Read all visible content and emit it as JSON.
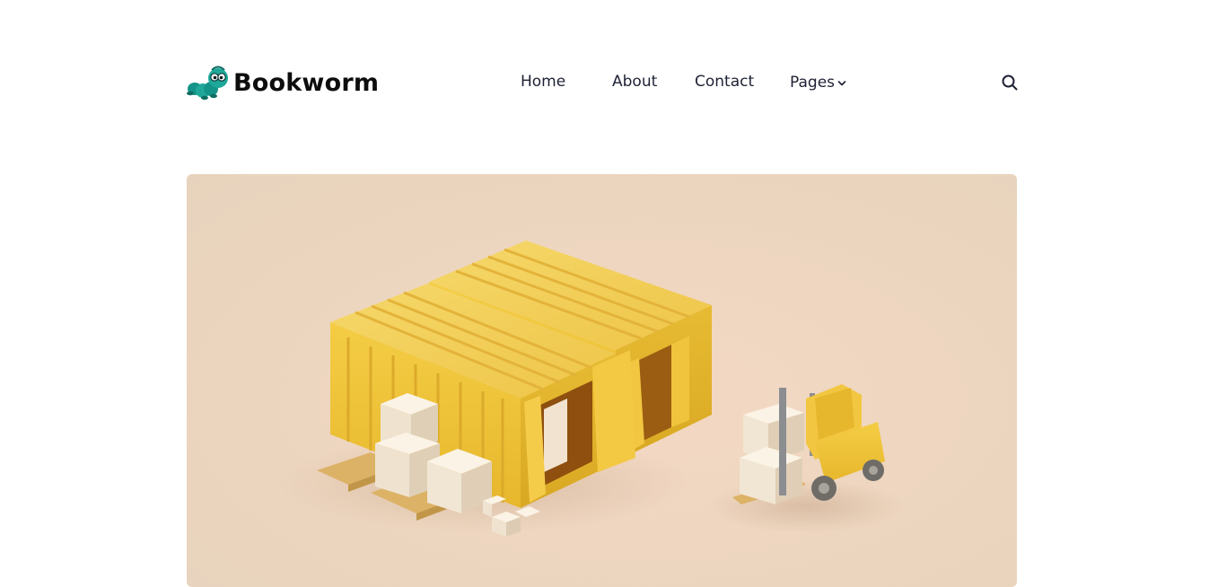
{
  "brand": {
    "name": "Bookworm",
    "logo_icon": "worm-mascot-icon",
    "accent_color": "#1fa89a"
  },
  "nav": {
    "items": [
      {
        "label": "Home"
      },
      {
        "label": "About"
      },
      {
        "label": "Contact"
      },
      {
        "label": "Pages",
        "has_dropdown": true
      }
    ],
    "search_icon": "search-icon"
  },
  "hero": {
    "image": "3d-illustration-yellow-shipping-containers-forklift-boxes",
    "background_color": "#eed6c0"
  }
}
